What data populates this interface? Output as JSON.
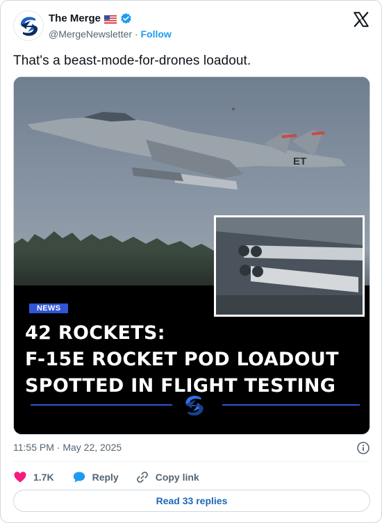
{
  "author": {
    "name": "The Merge",
    "flag_icon": "us-flag-icon",
    "verified_icon": "verified-badge-icon",
    "handle": "@MergeNewsletter",
    "separator": " · ",
    "follow_label": "Follow"
  },
  "platform_icon": "x-logo-icon",
  "tweet": {
    "text": "That's a beast-mode-for-drones loadout."
  },
  "media": {
    "tag": "NEWS",
    "headline_line1": "42 ROCKETS:",
    "headline_line2": "F-15E ROCKET POD LOADOUT",
    "headline_line3": "SPOTTED IN FLIGHT TESTING",
    "tail_code": "ET",
    "accent_color": "#2f56d6"
  },
  "meta": {
    "timestamp": "11:55 PM · May 22, 2025",
    "info_icon": "info-icon"
  },
  "actions": {
    "like_count": "1.7K",
    "reply_label": "Reply",
    "copy_link_label": "Copy link"
  },
  "replies": {
    "label": "Read 33 replies"
  },
  "colors": {
    "link_blue": "#1d9bf0",
    "like_pink": "#f91880",
    "muted_text": "#536471"
  }
}
